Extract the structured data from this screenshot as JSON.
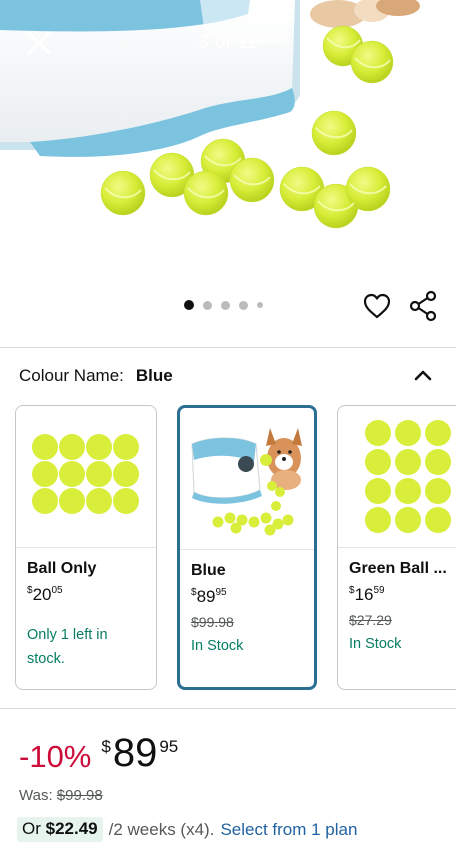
{
  "gallery": {
    "counter": "3 of 11",
    "dot_count": 5,
    "active_dot": 0
  },
  "colour": {
    "label": "Colour Name:",
    "value": "Blue"
  },
  "variants": [
    {
      "name": "Ball Only",
      "price_symbol": "$",
      "price_whole": "20",
      "price_fraction": "05",
      "was": "",
      "stock": "Only 1 left in stock.",
      "selected": false
    },
    {
      "name": "Blue",
      "price_symbol": "$",
      "price_whole": "89",
      "price_fraction": "95",
      "was": "$99.98",
      "stock": "In Stock",
      "selected": true
    },
    {
      "name": "Green Ball ...",
      "price_symbol": "$",
      "price_whole": "16",
      "price_fraction": "59",
      "was": "$27.29",
      "stock": "In Stock",
      "selected": false
    }
  ],
  "price": {
    "discount": "-10%",
    "symbol": "$",
    "whole": "89",
    "fraction": "95",
    "was_label": "Was:",
    "was_value": "$99.98"
  },
  "plan": {
    "prefix": "Or",
    "amount": "$22.49",
    "term": "/2 weeks (x4).",
    "link": "Select from 1 plan"
  },
  "colors": {
    "accent_link": "#2162a1",
    "discount_red": "#cc0c39",
    "stock_green": "#067d62",
    "selected_border": "#2a6e91",
    "machine_blue": "#7cc3e0",
    "ball_yellow": "#d9ee3a"
  },
  "icons": [
    "close-icon",
    "heart-icon",
    "share-icon",
    "chevron-up-icon"
  ]
}
